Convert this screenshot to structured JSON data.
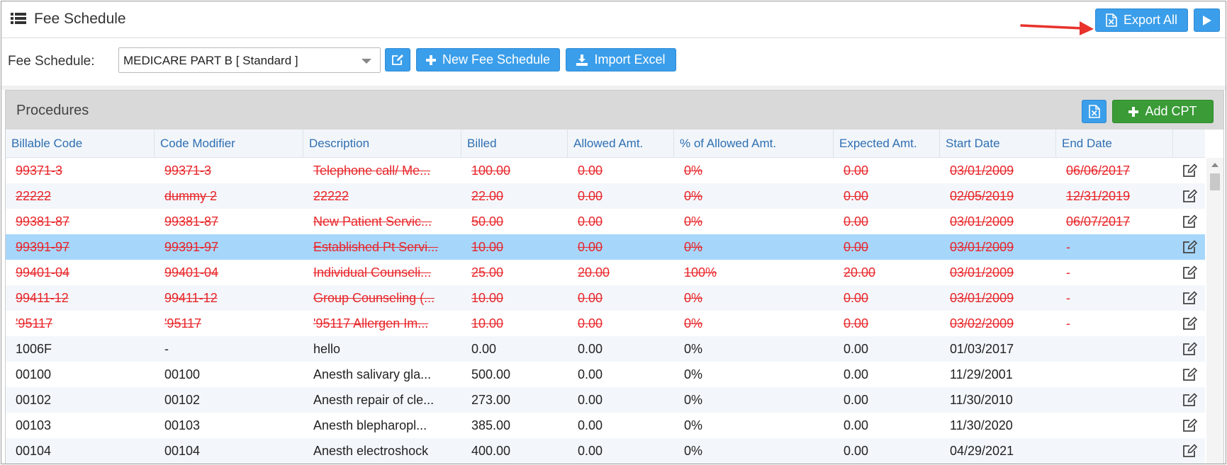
{
  "header": {
    "title": "Fee Schedule",
    "export_all_label": "Export All"
  },
  "toolbar": {
    "fee_schedule_label": "Fee Schedule:",
    "fee_schedule_value": "MEDICARE PART B [ Standard ]",
    "new_fee_schedule_label": "New Fee Schedule",
    "import_excel_label": "Import Excel"
  },
  "procedures": {
    "title": "Procedures",
    "add_cpt_label": "Add CPT",
    "columns": [
      "Billable Code",
      "Code Modifier",
      "Description",
      "Billed",
      "Allowed Amt.",
      "% of Allowed Amt.",
      "Expected Amt.",
      "Start Date",
      "End Date"
    ],
    "rows": [
      {
        "code": "99371-3",
        "modifier": "99371-3",
        "description": "Telephone call/ Me...",
        "billed": "100.00",
        "allowed": "0.00",
        "pct": "0%",
        "expected": "0.00",
        "start": "03/01/2009",
        "end": "06/06/2017",
        "deleted": true
      },
      {
        "code": "22222",
        "modifier": "dummy 2",
        "description": "22222",
        "billed": "22.00",
        "allowed": "0.00",
        "pct": "0%",
        "expected": "0.00",
        "start": "02/05/2019",
        "end": "12/31/2019",
        "deleted": true
      },
      {
        "code": "99381-87",
        "modifier": "99381-87",
        "description": "New Patient Servic...",
        "billed": "50.00",
        "allowed": "0.00",
        "pct": "0%",
        "expected": "0.00",
        "start": "03/01/2009",
        "end": "06/07/2017",
        "deleted": true
      },
      {
        "code": "99391-97",
        "modifier": "99391-97",
        "description": "Established Pt Servi...",
        "billed": "10.00",
        "allowed": "0.00",
        "pct": "0%",
        "expected": "0.00",
        "start": "03/01/2009",
        "end": "-",
        "deleted": true,
        "selected": true
      },
      {
        "code": "99401-04",
        "modifier": "99401-04",
        "description": "Individual Counseli...",
        "billed": "25.00",
        "allowed": "20.00",
        "pct": "100%",
        "expected": "20.00",
        "start": "03/01/2009",
        "end": "-",
        "deleted": true
      },
      {
        "code": "99411-12",
        "modifier": "99411-12",
        "description": "Group Counseling (...",
        "billed": "10.00",
        "allowed": "0.00",
        "pct": "0%",
        "expected": "0.00",
        "start": "03/01/2009",
        "end": "-",
        "deleted": true
      },
      {
        "code": "'95117",
        "modifier": "'95117",
        "description": "'95117 Allergen Im...",
        "billed": "10.00",
        "allowed": "0.00",
        "pct": "0%",
        "expected": "0.00",
        "start": "03/02/2009",
        "end": "-",
        "deleted": true
      },
      {
        "code": "1006F",
        "modifier": "-",
        "description": "hello",
        "billed": "0.00",
        "allowed": "0.00",
        "pct": "0%",
        "expected": "0.00",
        "start": "01/03/2017",
        "end": "",
        "deleted": false
      },
      {
        "code": "00100",
        "modifier": "00100",
        "description": "Anesth salivary gla...",
        "billed": "500.00",
        "allowed": "0.00",
        "pct": "0%",
        "expected": "0.00",
        "start": "11/29/2001",
        "end": "",
        "deleted": false
      },
      {
        "code": "00102",
        "modifier": "00102",
        "description": "Anesth repair of cle...",
        "billed": "273.00",
        "allowed": "0.00",
        "pct": "0%",
        "expected": "0.00",
        "start": "11/30/2010",
        "end": "",
        "deleted": false
      },
      {
        "code": "00103",
        "modifier": "00103",
        "description": "Anesth blepharopl...",
        "billed": "385.00",
        "allowed": "0.00",
        "pct": "0%",
        "expected": "0.00",
        "start": "11/30/2020",
        "end": "",
        "deleted": false
      },
      {
        "code": "00104",
        "modifier": "00104",
        "description": "Anesth electroshock",
        "billed": "400.00",
        "allowed": "0.00",
        "pct": "0%",
        "expected": "0.00",
        "start": "04/29/2021",
        "end": "",
        "deleted": false
      }
    ]
  },
  "colors": {
    "primary": "#3a9eea",
    "success": "#3a9b37",
    "deleted_text": "#e8262a",
    "selected_row": "#a7d6fb",
    "header_link": "#2f6fb2"
  },
  "icons": {
    "list": "list-icon",
    "excel": "excel-icon",
    "play": "play-icon",
    "edit": "edit-icon",
    "plus": "plus-icon",
    "download": "download-icon",
    "arrow": "arrow-icon"
  }
}
